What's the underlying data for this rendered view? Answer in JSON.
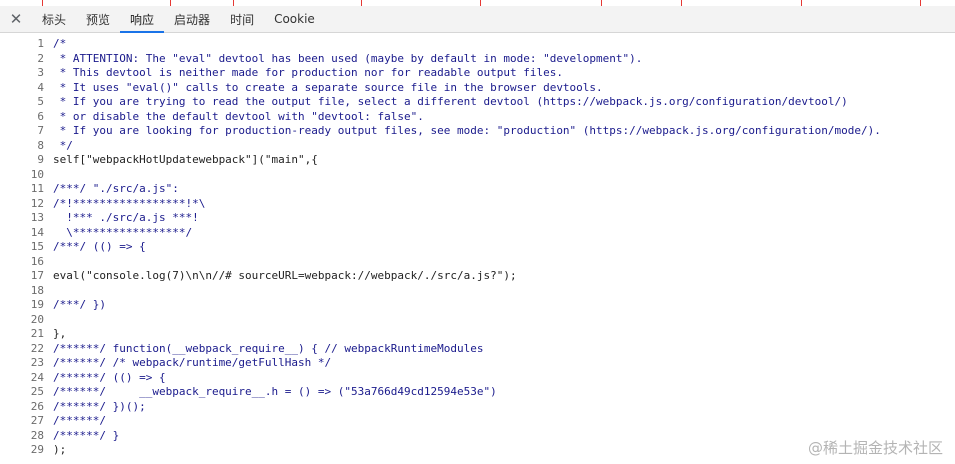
{
  "tabs": {
    "close_symbol": "✕",
    "items": [
      {
        "label": "标头",
        "active": false
      },
      {
        "label": "预览",
        "active": false
      },
      {
        "label": "响应",
        "active": true
      },
      {
        "label": "启动器",
        "active": false
      },
      {
        "label": "时间",
        "active": false
      },
      {
        "label": "Cookie",
        "active": false
      }
    ]
  },
  "code": {
    "lines": [
      {
        "n": "1",
        "text": "/*"
      },
      {
        "n": "2",
        "text": " * ATTENTION: The \"eval\" devtool has been used (maybe by default in mode: \"development\")."
      },
      {
        "n": "3",
        "text": " * This devtool is neither made for production nor for readable output files."
      },
      {
        "n": "4",
        "text": " * It uses \"eval()\" calls to create a separate source file in the browser devtools."
      },
      {
        "n": "5",
        "text": " * If you are trying to read the output file, select a different devtool (https://webpack.js.org/configuration/devtool/)"
      },
      {
        "n": "6",
        "text": " * or disable the default devtool with \"devtool: false\"."
      },
      {
        "n": "7",
        "text": " * If you are looking for production-ready output files, see mode: \"production\" (https://webpack.js.org/configuration/mode/)."
      },
      {
        "n": "8",
        "text": " */"
      },
      {
        "n": "9",
        "text": "self[\"webpackHotUpdatewebpack\"](\"main\",{"
      },
      {
        "n": "10",
        "text": ""
      },
      {
        "n": "11",
        "text": "/***/ \"./src/a.js\":"
      },
      {
        "n": "12",
        "text": "/*!*****************!*\\"
      },
      {
        "n": "13",
        "text": "  !*** ./src/a.js ***!"
      },
      {
        "n": "14",
        "text": "  \\*****************/"
      },
      {
        "n": "15",
        "text": "/***/ (() => {"
      },
      {
        "n": "16",
        "text": ""
      },
      {
        "n": "17",
        "text": "eval(\"console.log(7)\\n\\n//# sourceURL=webpack://webpack/./src/a.js?\");"
      },
      {
        "n": "18",
        "text": ""
      },
      {
        "n": "19",
        "text": "/***/ })"
      },
      {
        "n": "20",
        "text": ""
      },
      {
        "n": "21",
        "text": "},"
      },
      {
        "n": "22",
        "text": "/******/ function(__webpack_require__) { // webpackRuntimeModules"
      },
      {
        "n": "23",
        "text": "/******/ /* webpack/runtime/getFullHash */"
      },
      {
        "n": "24",
        "text": "/******/ (() => {"
      },
      {
        "n": "25",
        "text": "/******/     __webpack_require__.h = () => (\"53a766d49cd12594e53e\")"
      },
      {
        "n": "26",
        "text": "/******/ })();"
      },
      {
        "n": "27",
        "text": "/******/"
      },
      {
        "n": "28",
        "text": "/******/ }"
      },
      {
        "n": "29",
        "text": ");"
      }
    ]
  },
  "watermark": "@稀土掘金技术社区"
}
